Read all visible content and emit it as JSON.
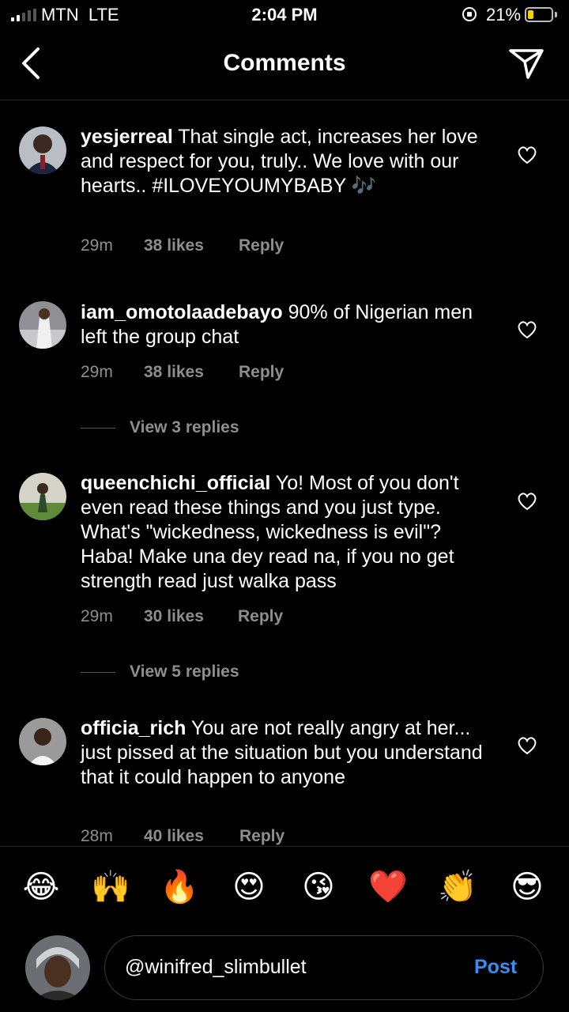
{
  "status_bar": {
    "carrier": "MTN  LTE",
    "time": "2:04 PM",
    "battery": "21%"
  },
  "header": {
    "title": "Comments"
  },
  "comments": [
    {
      "user": "yesjerreal",
      "text": " That single act, increases her love and respect for you, truly.. We love with our hearts.. #ILOVEYOUMYBABY 🎶",
      "time": "29m",
      "likes": "38 likes",
      "reply": "Reply"
    },
    {
      "user": "iam_omotolaadebayo",
      "text": " 90% of Nigerian men left the group chat",
      "time": "29m",
      "likes": "38 likes",
      "reply": "Reply",
      "view_replies": "View 3 replies"
    },
    {
      "user": "queenchichi_official",
      "text": " Yo! Most of you don't even read these things and you just type. What's \"wickedness, wickedness is evil\"? Haba! Make una dey read na, if you no get strength read just walka pass",
      "time": "29m",
      "likes": "30 likes",
      "reply": "Reply",
      "view_replies": "View 5 replies"
    },
    {
      "user": "officia_rich",
      "text": " You are not really angry at her... just pissed at the situation but you understand that it could happen to anyone",
      "time": "28m",
      "likes": "40 likes",
      "reply": "Reply"
    }
  ],
  "emoji_bar": [
    "😂",
    "🙌",
    "🔥",
    "😍",
    "😘",
    "❤️",
    "👏",
    "😎"
  ],
  "composer": {
    "value": "@winifred_slimbullet",
    "post_label": "Post"
  },
  "colors": {
    "background": "#000000",
    "meta": "#8e8e8e",
    "post": "#3b8ef0"
  }
}
